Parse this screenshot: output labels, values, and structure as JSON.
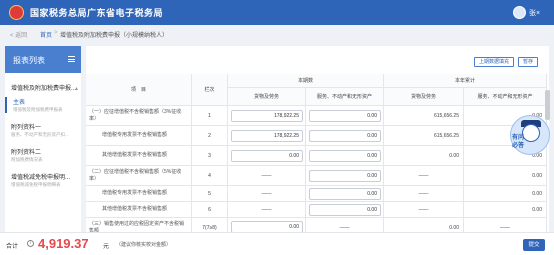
{
  "header": {
    "title": "国家税务总局广东省电子税务局",
    "user_name": "张×"
  },
  "breadcrumb": {
    "back": "< 返回",
    "home": "首页",
    "separator": ">",
    "current": "增值税及附加税费申报（小规模纳税人）"
  },
  "sidebar": {
    "title": "报表列表",
    "items": [
      {
        "label": "增值税及附加税费申报...",
        "sub": ""
      },
      {
        "label": "主表",
        "sub": "增值税及附加税费申报表"
      },
      {
        "label": "附列资料一",
        "sub": "服务、不动产和无形资产扣..."
      },
      {
        "label": "附列资料二",
        "sub": "附加税费情况表"
      },
      {
        "label": "增值税减免税申报明...",
        "sub": "增值税减免税申报明细表"
      }
    ]
  },
  "toolbar": {
    "use_last_data": "上期数据填充",
    "save": "暂存"
  },
  "table": {
    "col_project": "项　目",
    "col_line": "栏次",
    "group_current": "本期数",
    "group_ytd": "本年累计",
    "sub_goods": "货物及劳务",
    "sub_services": "服务、不动产和无形资产",
    "rows": [
      {
        "label": "（一）应征增值税不含税销售额（3%征收率）",
        "line": "1",
        "cur_goods": "178,922.25",
        "cur_services": "0.00",
        "ytd_goods": "615,656.25",
        "ytd_services": "0.00"
      },
      {
        "label": "增值税专用发票不含税销售额",
        "line": "2",
        "cur_goods": "178,922.25",
        "cur_services": "0.00",
        "ytd_goods": "615,656.25",
        "ytd_services": "0.00"
      },
      {
        "label": "其他增值税发票不含税销售额",
        "line": "3",
        "cur_goods": "0.00",
        "cur_services": "0.00",
        "ytd_goods": "0.00",
        "ytd_services": "0.00"
      },
      {
        "label": "（二）应征增值税不含税销售额（5%征收率）",
        "line": "4",
        "cur_goods": "——",
        "cur_services": "0.00",
        "ytd_goods": "——",
        "ytd_services": "0.00"
      },
      {
        "label": "增值税专用发票不含税销售额",
        "line": "5",
        "cur_goods": "——",
        "cur_services": "0.00",
        "ytd_goods": "——",
        "ytd_services": "0.00"
      },
      {
        "label": "其他增值税发票不含税销售额",
        "line": "6",
        "cur_goods": "——",
        "cur_services": "0.00",
        "ytd_goods": "——",
        "ytd_services": "0.00"
      },
      {
        "label": "（三）销售使用过的应税固定资产不含税销售额",
        "line": "7(7≥8)",
        "cur_goods": "0.00",
        "cur_services": "——",
        "ytd_goods": "0.00",
        "ytd_services": "——"
      }
    ]
  },
  "assistant": {
    "line1": "有问",
    "line2": "必答"
  },
  "footer": {
    "label": "合计",
    "info_icon": "i",
    "amount": "4,919.37",
    "unit": "元",
    "note": "（建议你核实校对金额）",
    "submit": "提交"
  }
}
